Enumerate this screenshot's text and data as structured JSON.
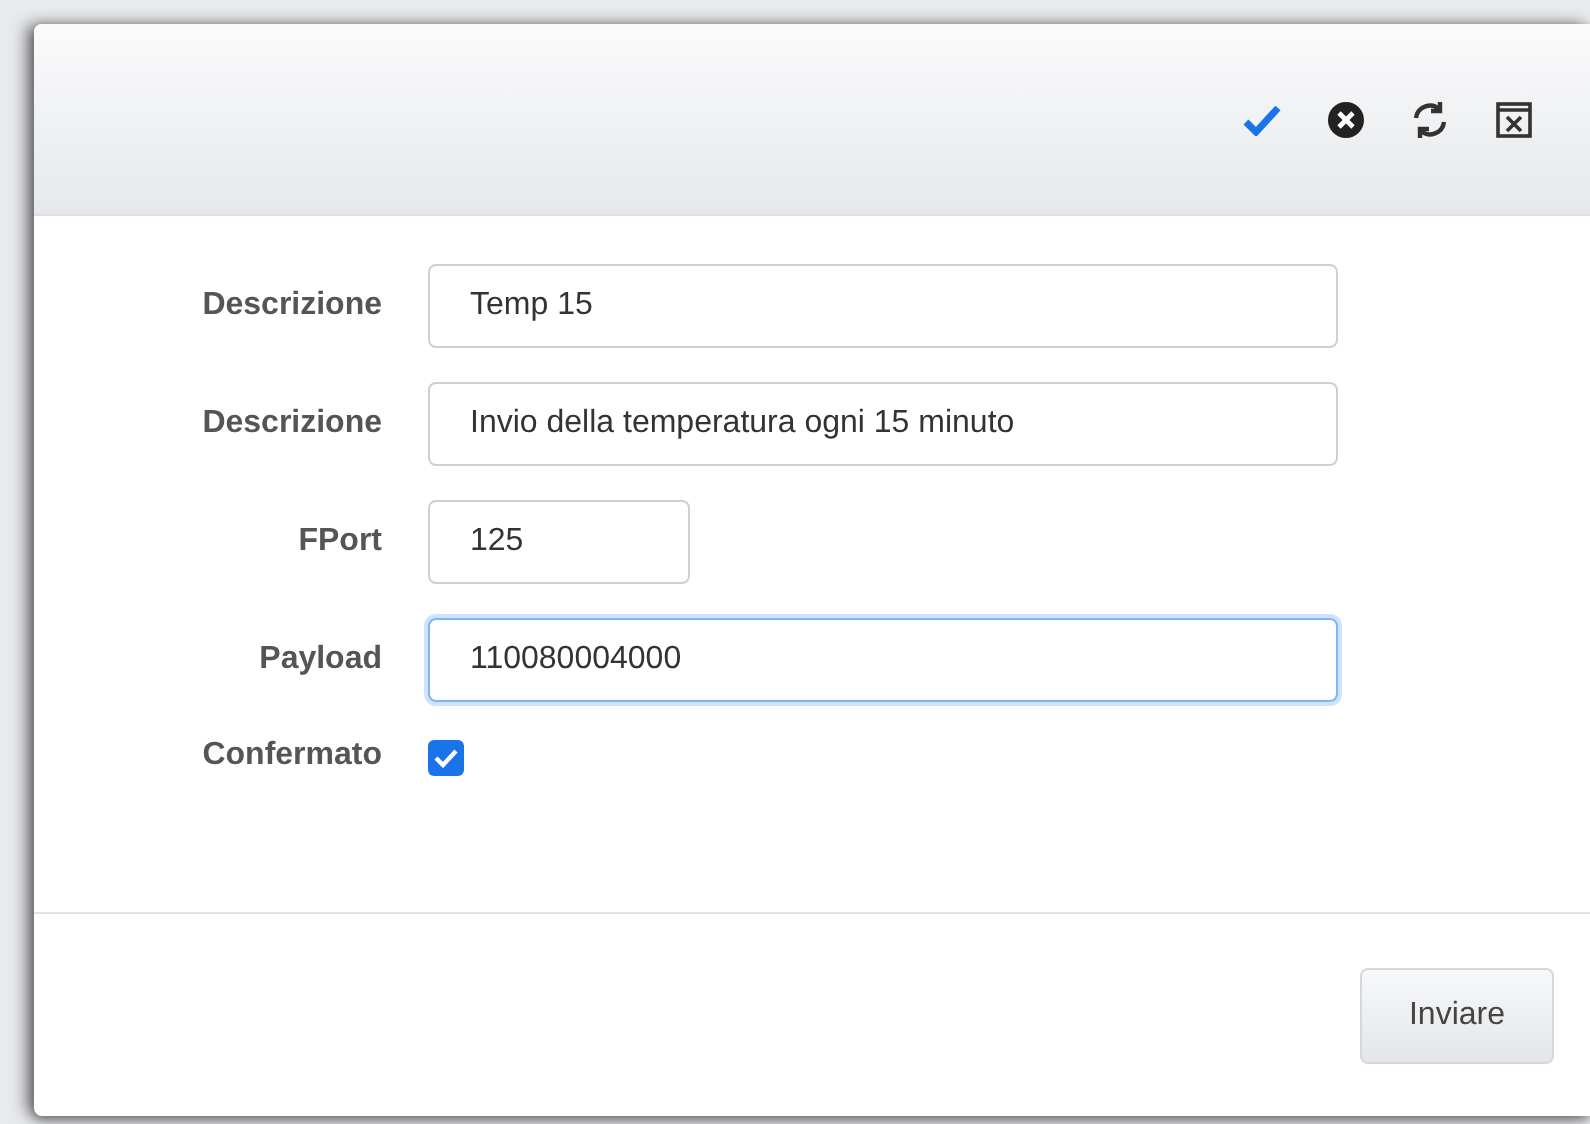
{
  "fields": [
    {
      "label": "Descrizione",
      "kind": "text",
      "value": "Temp 15",
      "focused": false
    },
    {
      "label": "Descrizione",
      "kind": "text",
      "value": "Invio della temperatura ogni 15 minuto",
      "focused": false
    },
    {
      "label": "FPort",
      "kind": "short",
      "value": "125",
      "focused": false
    },
    {
      "label": "Payload",
      "kind": "text",
      "value": "110080004000",
      "focused": true
    },
    {
      "label": "Confermato",
      "kind": "checkbox",
      "checked": true
    }
  ],
  "buttons": [
    "Inviare"
  ]
}
